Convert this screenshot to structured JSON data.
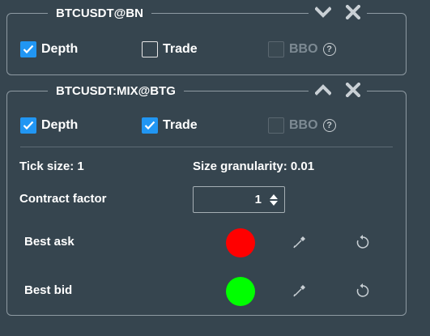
{
  "panels": [
    {
      "title": "BTCUSDT@BN",
      "depth_label": "Depth",
      "trade_label": "Trade",
      "bbo_label": "BBO",
      "help_glyph": "?",
      "depth_checked": true,
      "trade_checked": false,
      "bbo_enabled": false,
      "collapse_icon": "chevron-down-icon",
      "close_icon": "close-icon"
    },
    {
      "title": "BTCUSDT:MIX@BTG",
      "depth_label": "Depth",
      "trade_label": "Trade",
      "bbo_label": "BBO",
      "help_glyph": "?",
      "depth_checked": true,
      "trade_checked": true,
      "bbo_enabled": false,
      "collapse_icon": "chevron-up-icon",
      "close_icon": "close-icon",
      "tick_size": "Tick size: 1",
      "size_granularity": "Size granularity: 0.01",
      "contract_factor_label": "Contract factor",
      "contract_factor_value": "1",
      "best_ask_label": "Best ask",
      "best_ask_color": "#ff0000",
      "best_bid_label": "Best bid",
      "best_bid_color": "#00ff00"
    }
  ],
  "colors": {
    "background": "#36454f",
    "checkbox_accent": "#2196f3",
    "border": "#8e9aa2"
  }
}
